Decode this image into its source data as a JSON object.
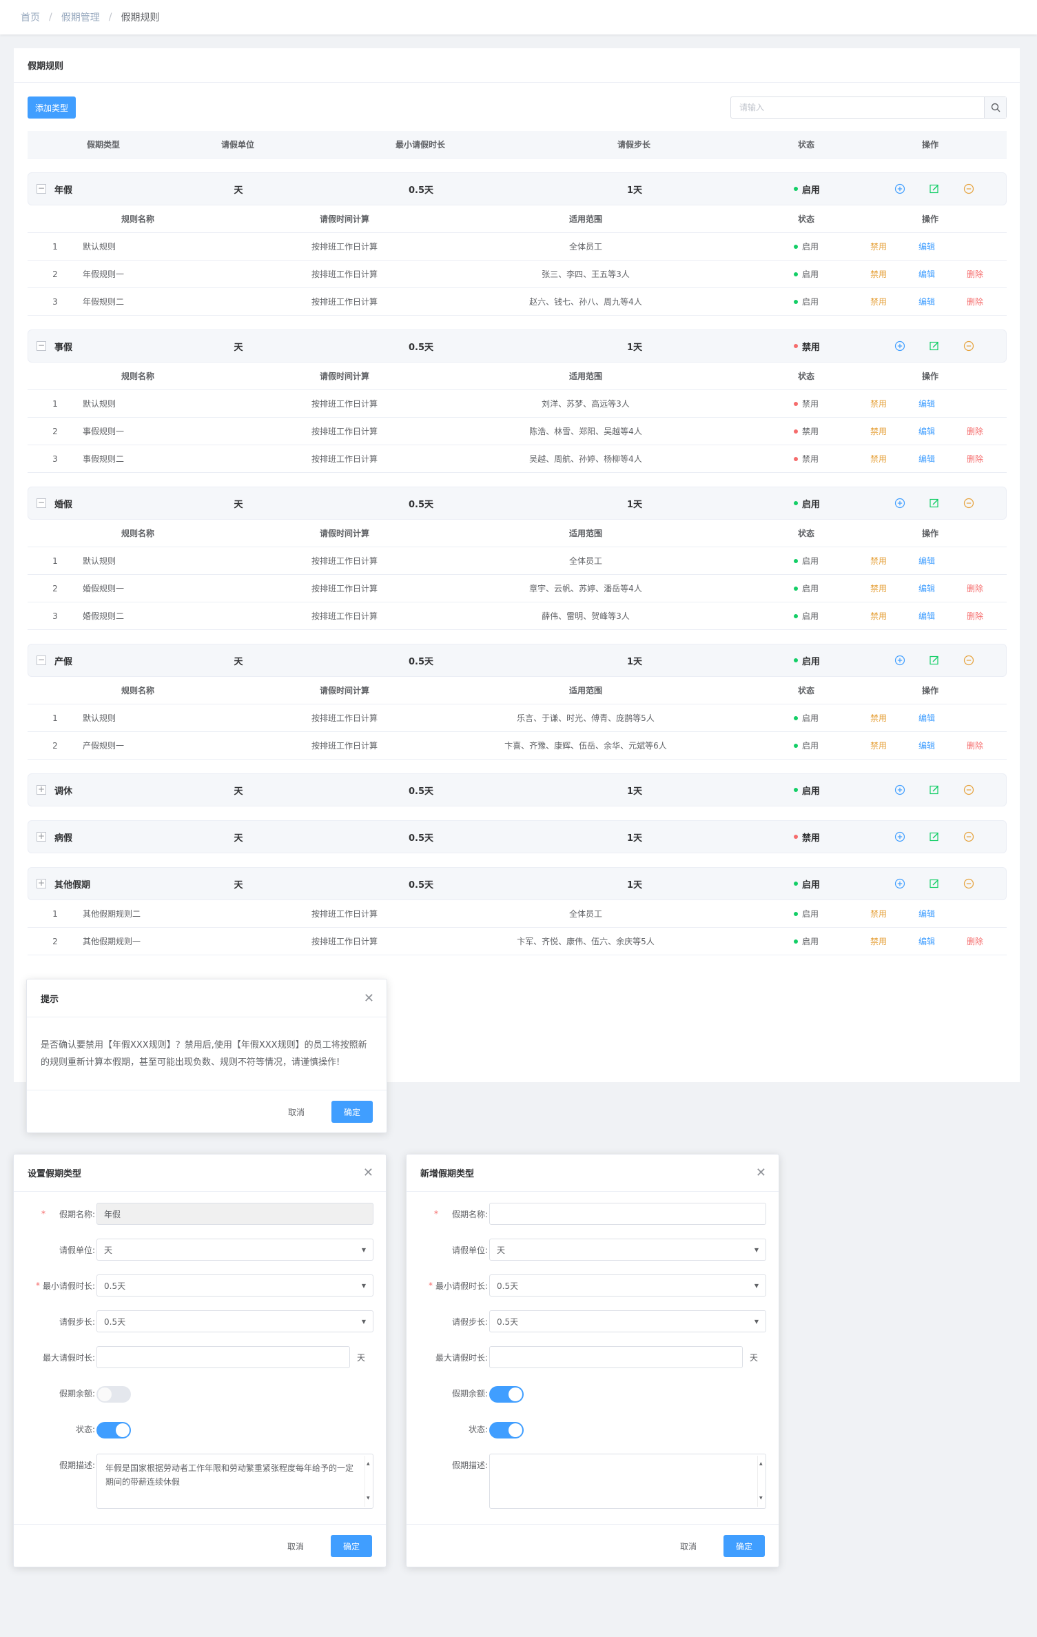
{
  "breadcrumb": [
    "首页",
    "假期管理",
    "假期规则"
  ],
  "card_title": "假期规则",
  "add_button": "添加类型",
  "search": {
    "placeholder": "请输入"
  },
  "columns": [
    "假期类型",
    "请假单位",
    "最小请假时长",
    "请假步长",
    "状态",
    "操作"
  ],
  "sub_columns": [
    "规则名称",
    "请假时间计算",
    "适用范围",
    "状态",
    "操作"
  ],
  "actions": {
    "disable": "禁用",
    "edit": "编辑",
    "delete": "删除"
  },
  "colors": {
    "primary": "#409eff",
    "success": "#13ce66",
    "danger": "#f56c6c",
    "warning": "#e6a23c"
  },
  "groups": [
    {
      "name": "年假",
      "unit": "天",
      "min": "0.5天",
      "step": "1天",
      "status": "启用",
      "enabled": true,
      "expanded": true,
      "show_sub_header": true,
      "rules": [
        {
          "no": "1",
          "name": "默认规则",
          "calc": "按排班工作日计算",
          "scope": "全体员工",
          "status": "启用",
          "enabled": true,
          "deletable": false
        },
        {
          "no": "2",
          "name": "年假规则一",
          "calc": "按排班工作日计算",
          "scope": "张三、李四、王五等3人",
          "status": "启用",
          "enabled": true,
          "deletable": true
        },
        {
          "no": "3",
          "name": "年假规则二",
          "calc": "按排班工作日计算",
          "scope": "赵六、钱七、孙八、周九等4人",
          "status": "启用",
          "enabled": true,
          "deletable": true
        }
      ]
    },
    {
      "name": "事假",
      "unit": "天",
      "min": "0.5天",
      "step": "1天",
      "status": "禁用",
      "enabled": false,
      "expanded": true,
      "show_sub_header": true,
      "rules": [
        {
          "no": "1",
          "name": "默认规则",
          "calc": "按排班工作日计算",
          "scope": "刘洋、苏梦、高远等3人",
          "status": "禁用",
          "enabled": false,
          "deletable": false
        },
        {
          "no": "2",
          "name": "事假规则一",
          "calc": "按排班工作日计算",
          "scope": "陈浩、林雪、郑阳、吴越等4人",
          "status": "禁用",
          "enabled": false,
          "deletable": true
        },
        {
          "no": "3",
          "name": "事假规则二",
          "calc": "按排班工作日计算",
          "scope": "吴越、周航、孙婷、杨柳等4人",
          "status": "禁用",
          "enabled": false,
          "deletable": true
        }
      ]
    },
    {
      "name": "婚假",
      "unit": "天",
      "min": "0.5天",
      "step": "1天",
      "status": "启用",
      "enabled": true,
      "expanded": true,
      "show_sub_header": true,
      "rules": [
        {
          "no": "1",
          "name": "默认规则",
          "calc": "按排班工作日计算",
          "scope": "全体员工",
          "status": "启用",
          "enabled": true,
          "deletable": false
        },
        {
          "no": "2",
          "name": "婚假规则一",
          "calc": "按排班工作日计算",
          "scope": "章宇、云帆、苏婷、潘岳等4人",
          "status": "启用",
          "enabled": true,
          "deletable": true
        },
        {
          "no": "3",
          "name": "婚假规则二",
          "calc": "按排班工作日计算",
          "scope": "薛伟、雷明、贺峰等3人",
          "status": "启用",
          "enabled": true,
          "deletable": true
        }
      ]
    },
    {
      "name": "产假",
      "unit": "天",
      "min": "0.5天",
      "step": "1天",
      "status": "启用",
      "enabled": true,
      "expanded": true,
      "show_sub_header": true,
      "rules": [
        {
          "no": "1",
          "name": "默认规则",
          "calc": "按排班工作日计算",
          "scope": "乐言、于谦、时光、傅青、庞鹊等5人",
          "status": "启用",
          "enabled": true,
          "deletable": false
        },
        {
          "no": "2",
          "name": "产假规则一",
          "calc": "按排班工作日计算",
          "scope": "卞喜、齐豫、康辉、伍岳、余华、元斌等6人",
          "status": "启用",
          "enabled": true,
          "deletable": true
        }
      ]
    },
    {
      "name": "调休",
      "unit": "天",
      "min": "0.5天",
      "step": "1天",
      "status": "启用",
      "enabled": true,
      "expanded": false,
      "show_sub_header": false,
      "rules": []
    },
    {
      "name": "病假",
      "unit": "天",
      "min": "0.5天",
      "step": "1天",
      "status": "禁用",
      "enabled": false,
      "expanded": false,
      "show_sub_header": false,
      "rules": []
    },
    {
      "name": "其他假期",
      "unit": "天",
      "min": "0.5天",
      "step": "1天",
      "status": "启用",
      "enabled": true,
      "expanded": false,
      "show_sub_header": false,
      "rules": [
        {
          "no": "1",
          "name": "其他假期规则二",
          "calc": "按排班工作日计算",
          "scope": "全体员工",
          "status": "启用",
          "enabled": true,
          "deletable": false
        },
        {
          "no": "2",
          "name": "其他假期规则一",
          "calc": "按排班工作日计算",
          "scope": "卞军、齐悦、康伟、伍六、余庆等5人",
          "status": "启用",
          "enabled": true,
          "deletable": true
        }
      ]
    }
  ],
  "confirm_dialog": {
    "title": "提示",
    "message": "是否确认要禁用【年假XXX规则】？禁用后,使用【年假XXX规则】的员工将按照新的规则重新计算本假期，甚至可能出现负数、规则不符等情况，请谨慎操作!",
    "cancel": "取消",
    "ok": "确定"
  },
  "set_dialog": {
    "title": "设置假期类型",
    "labels": {
      "name": "假期名称:",
      "unit": "请假单位:",
      "min": "最小请假时长:",
      "step": "请假步长:",
      "max": "最大请假时长:",
      "balance": "假期余额:",
      "status": "状态:",
      "desc": "假期描述:"
    },
    "values": {
      "name": "年假",
      "unit": "天",
      "min": "0.5天",
      "step": "0.5天",
      "max": "",
      "max_unit": "天",
      "balance_on": false,
      "status_on": true,
      "desc": "年假是国家根据劳动者工作年限和劳动繁重紧张程度每年给予的一定期间的带薪连续休假"
    },
    "cancel": "取消",
    "ok": "确定"
  },
  "new_dialog": {
    "title": "新增假期类型",
    "labels": {
      "name": "假期名称:",
      "unit": "请假单位:",
      "min": "最小请假时长:",
      "step": "请假步长:",
      "max": "最大请假时长:",
      "balance": "假期余额:",
      "status": "状态:",
      "desc": "假期描述:"
    },
    "values": {
      "name": "",
      "unit": "天",
      "min": "0.5天",
      "step": "0.5天",
      "max": "",
      "max_unit": "天",
      "balance_on": true,
      "status_on": true,
      "desc": ""
    },
    "cancel": "取消",
    "ok": "确定"
  }
}
